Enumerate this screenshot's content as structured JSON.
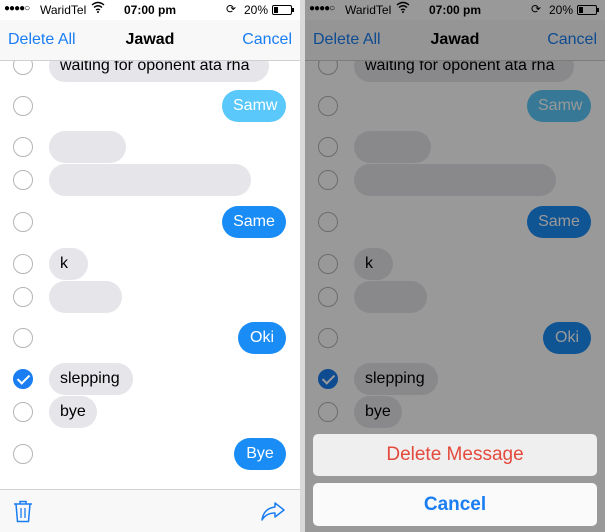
{
  "status": {
    "signal": "●●●●○",
    "carrier": "WaridTel",
    "time": "07:00 pm",
    "battery": "20%",
    "battery_fraction": 0.2
  },
  "nav": {
    "left": "Delete All",
    "title": "Jawad",
    "right": "Cancel"
  },
  "messages": [
    {
      "text": "waiting for oponent ata rha",
      "dir": "in",
      "checked": false
    },
    {
      "text": "Samw",
      "dir": "out",
      "checked": false
    },
    {
      "text": "",
      "dir": "in",
      "checked": false
    },
    {
      "text": "",
      "dir": "in",
      "checked": false
    },
    {
      "text": "Same",
      "dir": "out",
      "checked": false
    },
    {
      "text": "k",
      "dir": "in",
      "checked": false
    },
    {
      "text": "",
      "dir": "in",
      "checked": false
    },
    {
      "text": "Oki",
      "dir": "out",
      "checked": false
    },
    {
      "text": "slepping",
      "dir": "in",
      "checked": true
    },
    {
      "text": "bye",
      "dir": "in",
      "checked": false
    },
    {
      "text": "Bye",
      "dir": "out",
      "checked": false
    }
  ],
  "action_sheet": {
    "delete": "Delete Message",
    "cancel": "Cancel"
  },
  "colors": {
    "accent": "#1a7ef2",
    "outgoing": "#1a8cf5",
    "incoming": "#e5e5ea",
    "destructive": "#e4493c"
  },
  "icons": {
    "toolbar_left": "trash-icon",
    "toolbar_right": "share-arrow-icon"
  }
}
